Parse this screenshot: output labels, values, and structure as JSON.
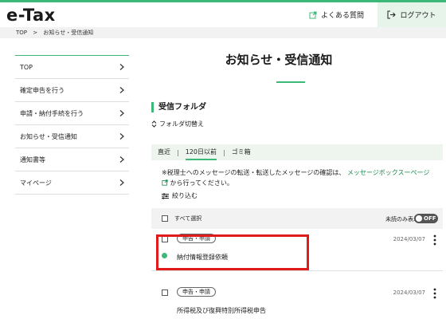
{
  "header": {
    "logo": "e-Tax",
    "faq_label": "よくある質問",
    "logout_label": "ログアウト"
  },
  "breadcrumb": [
    "TOP",
    ">",
    "お知らせ・受信通知"
  ],
  "sidebar": {
    "items": [
      {
        "label": "TOP"
      },
      {
        "label": "確定申告を行う"
      },
      {
        "label": "申請・納付手続を行う"
      },
      {
        "label": "お知らせ・受信通知"
      },
      {
        "label": "通知書等"
      },
      {
        "label": "マイページ"
      }
    ]
  },
  "main": {
    "title": "お知らせ・受信通知",
    "folder_title": "受信フォルダ",
    "folder_switch": "フォルダ切替え",
    "tabs": [
      {
        "label": "直近"
      },
      {
        "label": "120日以前"
      },
      {
        "label": "ゴミ箱"
      }
    ],
    "notice_before": "※税理士へのメッセージの転送・転送したメッセージの確認は、",
    "notice_link": "メッセージボックスーページ",
    "notice_after": "から行ってください。",
    "filter_label": "絞り込む",
    "select_all": "すべて選択",
    "unread_only": "未読のみ表示",
    "toggle_state": "OFF"
  },
  "messages": [
    {
      "tag": "申告・申請",
      "date": "2024/03/07",
      "subject": "納付情報登録依頼",
      "unread": true
    },
    {
      "tag": "申告・申請",
      "date": "2024/03/07",
      "subject": "所得税及び復興特別所得税申告",
      "unread": false
    }
  ],
  "colors": {
    "accent": "#3cb878",
    "highlight": "#e01b1b",
    "link": "#0f8a4a"
  }
}
